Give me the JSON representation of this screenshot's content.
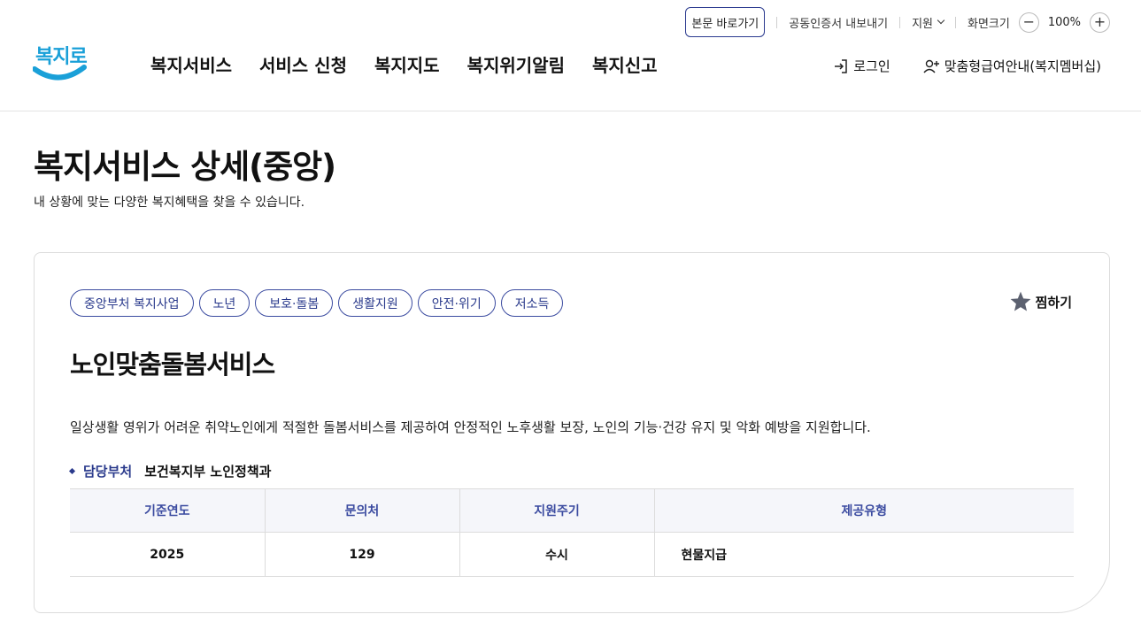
{
  "utility": {
    "skip_link": "본문 바로가기",
    "cert_export": "공동인증서 내보내기",
    "support": "지원",
    "zoom_label": "화면크기",
    "zoom_value": "100%",
    "zoom_out": "−",
    "zoom_in": "+"
  },
  "logo": {
    "text": "복지로"
  },
  "nav": {
    "items": [
      "복지서비스",
      "서비스 신청",
      "복지지도",
      "복지위기알림",
      "복지신고"
    ]
  },
  "member": {
    "login": "로그인",
    "custom_guide": "맞춤형급여안내(복지멤버십)"
  },
  "page": {
    "title": "복지서비스 상세(중앙)",
    "description": "내 상황에 맞는 다양한 복지혜택을 찾을 수 있습니다."
  },
  "service": {
    "tags": [
      "중앙부처 복지사업",
      "노년",
      "보호·돌봄",
      "생활지원",
      "안전·위기",
      "저소득"
    ],
    "favorite": "찜하기",
    "title": "노인맞춤돌봄서비스",
    "description": "일상생활 영위가 어려운 취약노인에게 적절한 돌봄서비스를 제공하여 안정적인 노후생활 보장, 노인의 기능·건강 유지 및 악화 예방을 지원합니다.",
    "dept_label": "담당부처",
    "dept_value": "보건복지부 노인정책과",
    "table": {
      "headers": [
        "기준연도",
        "문의처",
        "지원주기",
        "제공유형"
      ],
      "rows": [
        [
          "2025",
          "129",
          "수시",
          "현물지급"
        ]
      ]
    }
  },
  "colors": {
    "accent": "#2a3a8c",
    "logo": "#1aa0d8",
    "header_bg": "#f5f6fa"
  }
}
